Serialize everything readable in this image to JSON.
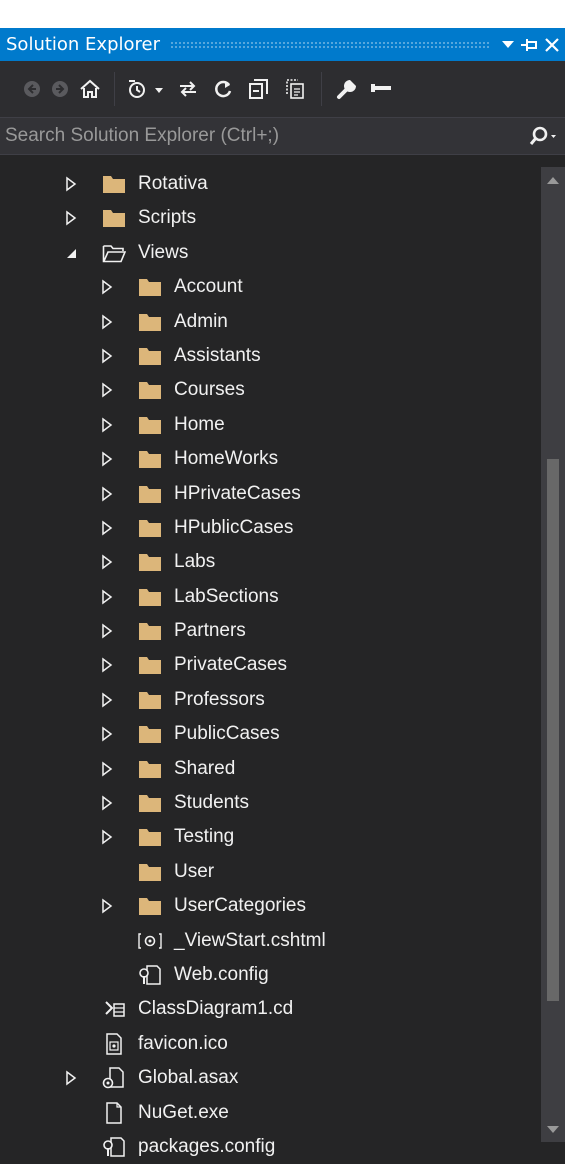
{
  "window": {
    "title": "Solution Explorer",
    "accent_color": "#007acc",
    "buttons": [
      {
        "name": "dropdown-arrow-icon"
      },
      {
        "name": "pin-icon"
      },
      {
        "name": "close-icon"
      }
    ]
  },
  "toolbar": {
    "buttons": [
      {
        "name": "back-icon"
      },
      {
        "name": "forward-icon"
      },
      {
        "name": "home-icon"
      },
      {
        "name": "pending-changes-filter-icon"
      },
      {
        "name": "sync-with-active-document-icon"
      },
      {
        "name": "refresh-icon"
      },
      {
        "name": "collapse-all-icon"
      },
      {
        "name": "show-all-files-icon"
      },
      {
        "name": "properties-wrench-icon"
      },
      {
        "name": "preview-selected-items-icon"
      }
    ]
  },
  "search": {
    "placeholder": "Search Solution Explorer (Ctrl+;)",
    "value": ""
  },
  "tree": {
    "items": [
      {
        "label": "Rotativa",
        "type": "folder",
        "level": 0,
        "expander": "collapsed"
      },
      {
        "label": "Scripts",
        "type": "folder",
        "level": 0,
        "expander": "collapsed"
      },
      {
        "label": "Views",
        "type": "folder-open",
        "level": 0,
        "expander": "expanded"
      },
      {
        "label": "Account",
        "type": "folder",
        "level": 1,
        "expander": "collapsed"
      },
      {
        "label": "Admin",
        "type": "folder",
        "level": 1,
        "expander": "collapsed"
      },
      {
        "label": "Assistants",
        "type": "folder",
        "level": 1,
        "expander": "collapsed"
      },
      {
        "label": "Courses",
        "type": "folder",
        "level": 1,
        "expander": "collapsed"
      },
      {
        "label": "Home",
        "type": "folder",
        "level": 1,
        "expander": "collapsed"
      },
      {
        "label": "HomeWorks",
        "type": "folder",
        "level": 1,
        "expander": "collapsed"
      },
      {
        "label": "HPrivateCases",
        "type": "folder",
        "level": 1,
        "expander": "collapsed"
      },
      {
        "label": "HPublicCases",
        "type": "folder",
        "level": 1,
        "expander": "collapsed"
      },
      {
        "label": "Labs",
        "type": "folder",
        "level": 1,
        "expander": "collapsed"
      },
      {
        "label": "LabSections",
        "type": "folder",
        "level": 1,
        "expander": "collapsed"
      },
      {
        "label": "Partners",
        "type": "folder",
        "level": 1,
        "expander": "collapsed"
      },
      {
        "label": "PrivateCases",
        "type": "folder",
        "level": 1,
        "expander": "collapsed"
      },
      {
        "label": "Professors",
        "type": "folder",
        "level": 1,
        "expander": "collapsed"
      },
      {
        "label": "PublicCases",
        "type": "folder",
        "level": 1,
        "expander": "collapsed"
      },
      {
        "label": "Shared",
        "type": "folder",
        "level": 1,
        "expander": "collapsed"
      },
      {
        "label": "Students",
        "type": "folder",
        "level": 1,
        "expander": "collapsed"
      },
      {
        "label": "Testing",
        "type": "folder",
        "level": 1,
        "expander": "collapsed"
      },
      {
        "label": "User",
        "type": "folder",
        "level": 1,
        "expander": "none"
      },
      {
        "label": "UserCategories",
        "type": "folder",
        "level": 1,
        "expander": "collapsed"
      },
      {
        "label": "_ViewStart.cshtml",
        "type": "cshtml",
        "level": 1,
        "expander": "none"
      },
      {
        "label": "Web.config",
        "type": "config",
        "level": 1,
        "expander": "none"
      },
      {
        "label": "ClassDiagram1.cd",
        "type": "classdiagram",
        "level": 0,
        "expander": "none"
      },
      {
        "label": "favicon.ico",
        "type": "ico",
        "level": 0,
        "expander": "none"
      },
      {
        "label": "Global.asax",
        "type": "asax",
        "level": 0,
        "expander": "collapsed"
      },
      {
        "label": "NuGet.exe",
        "type": "file",
        "level": 0,
        "expander": "none"
      },
      {
        "label": "packages.config",
        "type": "config",
        "level": 0,
        "expander": "none"
      }
    ]
  },
  "colors": {
    "background": "#252526",
    "toolbar": "#2d2d30",
    "search": "#333337",
    "folder": "#dcb67a",
    "text": "#f1f1f1"
  }
}
